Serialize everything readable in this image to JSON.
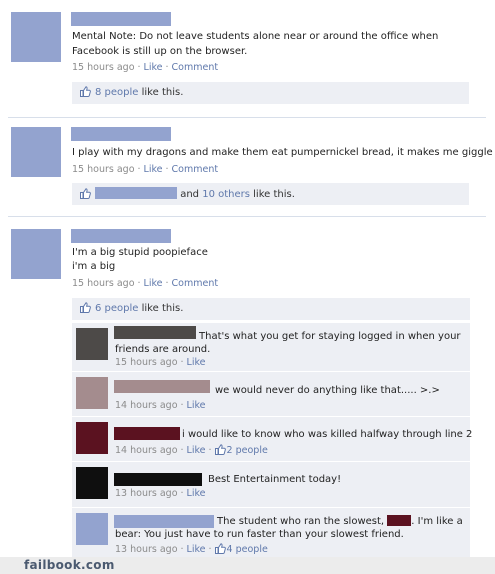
{
  "colors": {
    "link": "#5f78ab",
    "meta": "#8b8b8b",
    "like_box": "#edeff4",
    "avatar_blue": "#93a3cf"
  },
  "icons": {
    "like": "thumbs-up-icon"
  },
  "posts": [
    {
      "text": "Mental Note: Do not leave students alone near or around the office when Facebook is still up on the browser.",
      "time": "15 hours ago",
      "like_link": "Like",
      "comment_link": "Comment",
      "likes_count": "8 people",
      "likes_suffix": "like this."
    },
    {
      "text": "I play with my dragons and make them eat pumpernickel bread, it makes me giggle",
      "time": "15 hours ago",
      "like_link": "Like",
      "comment_link": "Comment",
      "likes_and": "and",
      "likes_others": "10 others",
      "likes_suffix": "like this."
    },
    {
      "text_line1": "I'm a big stupid poopieface",
      "text_line2": "i'm a big",
      "time": "15 hours ago",
      "like_link": "Like",
      "comment_link": "Comment",
      "likes_count": "6 people",
      "likes_suffix": "like this.",
      "comments": [
        {
          "text_line1": "That's what you get for staying logged in when your",
          "text_line2": "friends are around.",
          "time": "15 hours ago",
          "like_link": "Like"
        },
        {
          "text": "we would never do anything like that..... >.>",
          "time": "14 hours ago",
          "like_link": "Like"
        },
        {
          "text": "i would like to know who was killed halfway through line 2",
          "time": "14 hours ago",
          "like_link": "Like",
          "likes": "2 people"
        },
        {
          "text": "Best Entertainment today!",
          "time": "13 hours ago",
          "like_link": "Like"
        },
        {
          "text_line1a": "The student who ran the slowest,",
          "text_line1b": ". I'm like a",
          "text_line2": "bear: You just have to run faster than your slowest friend.",
          "time": "13 hours ago",
          "like_link": "Like",
          "likes": "4 people"
        }
      ]
    }
  ],
  "footer": {
    "logo": "failbook.com"
  }
}
